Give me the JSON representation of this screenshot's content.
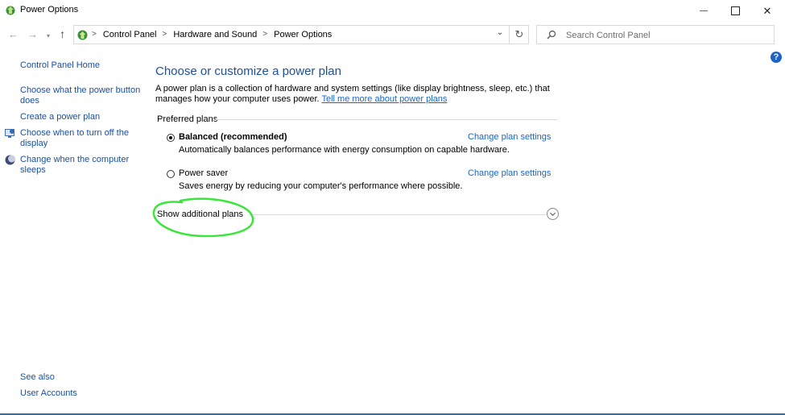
{
  "window": {
    "title": "Power Options",
    "minimize_glyph": "—",
    "close_glyph": "✕"
  },
  "address": {
    "back_glyph": "←",
    "forward_glyph": "→",
    "recent_glyph": "▾",
    "up_glyph": "↑",
    "breadcrumbs": [
      "Control Panel",
      "Hardware and Sound",
      "Power Options"
    ],
    "separator": ">",
    "dropdown_glyph": "⌄",
    "refresh_glyph": "↻"
  },
  "search": {
    "placeholder": "Search Control Panel"
  },
  "help_glyph": "?",
  "sidebar": {
    "home": "Control Panel Home",
    "items": [
      "Choose what the power button does",
      "Create a power plan",
      "Choose when to turn off the display",
      "Change when the computer sleeps"
    ],
    "see_also_label": "See also",
    "see_also_link": "User Accounts"
  },
  "main": {
    "title": "Choose or customize a power plan",
    "intro_text": "A power plan is a collection of hardware and system settings (like display brightness, sleep, etc.) that manages how your computer uses power. ",
    "intro_link": "Tell me more about power plans",
    "group_label": "Preferred plans",
    "plans": [
      {
        "name": "Balanced (recommended)",
        "description": "Automatically balances performance with energy consumption on capable hardware.",
        "selected": true,
        "change_link": "Change plan settings"
      },
      {
        "name": "Power saver",
        "description": "Saves energy by reducing your computer's performance where possible.",
        "selected": false,
        "change_link": "Change plan settings"
      }
    ],
    "show_additional": "Show additional plans"
  },
  "colors": {
    "link": "#1a66c7",
    "sidebar_link": "#1a50a0",
    "title": "#1f4e9a",
    "annotation": "#39e639"
  }
}
